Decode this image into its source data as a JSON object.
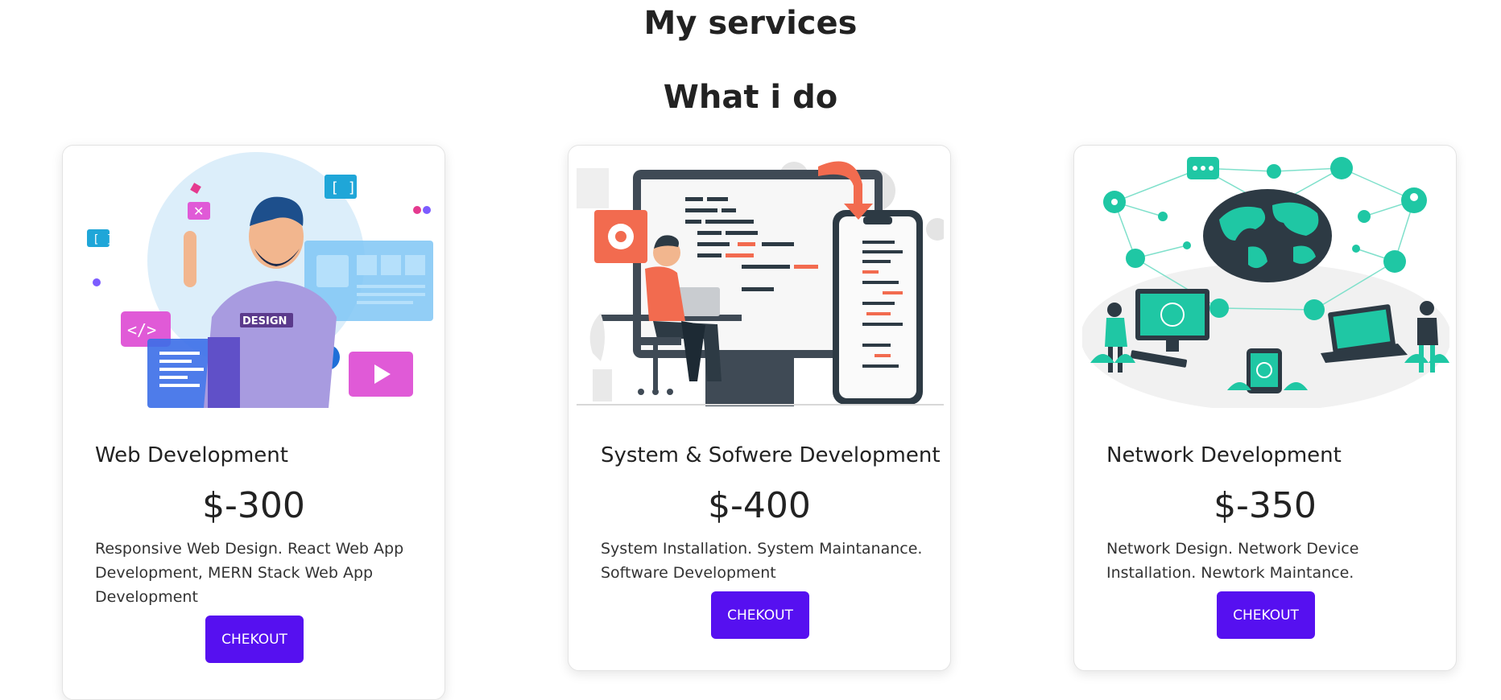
{
  "section": {
    "title": "My services",
    "subtitle": "What i do"
  },
  "services": [
    {
      "title": "Web Development",
      "price": "$-300",
      "description": "Responsive Web Design. React Web App Development, MERN Stack Web App Development",
      "button_label": "CHEKOUT",
      "illustration": "web-developer-illustration",
      "illustration_text": "DESIGN"
    },
    {
      "title": "System & Sofwere Development",
      "price": "$-400",
      "description": "System Installation. System Maintanance. Software Development",
      "button_label": "CHEKOUT",
      "illustration": "software-developer-illustration"
    },
    {
      "title": "Network Development",
      "price": "$-350",
      "description": "Network Design. Network Device Installation. Newtork Maintance.",
      "button_label": "CHEKOUT",
      "illustration": "network-globe-illustration"
    }
  ],
  "colors": {
    "button": "#5610f0",
    "accent_teal": "#1fc7a4",
    "accent_coral": "#f26b4f",
    "accent_purple": "#7c5cff"
  }
}
